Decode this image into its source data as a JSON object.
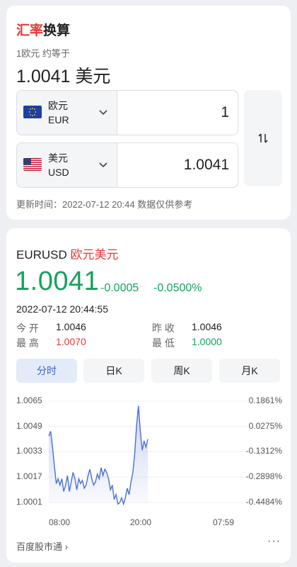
{
  "converter": {
    "title_part1": "汇率",
    "title_part2": "换算",
    "rate_caption": "1欧元 约等于",
    "rate_value": "1.0041 美元",
    "from": {
      "name": "欧元",
      "code": "EUR",
      "amount": "1",
      "flag": "eu-flag-icon"
    },
    "to": {
      "name": "美元",
      "code": "USD",
      "amount": "1.0041",
      "flag": "us-flag-icon"
    },
    "swap_icon": "swap-arrows-icon",
    "update_label": "更新时间：2022-07-12 20:44 数据仅供参考"
  },
  "quote": {
    "symbol": "EURUSD",
    "name": "欧元美元",
    "price": "1.0041",
    "change": "-0.0005",
    "change_pct": "-0.0500%",
    "time": "2022-07-12 20:44:55",
    "open_label": "今  开",
    "open_value": "1.0046",
    "prev_close_label": "昨  收",
    "prev_close_value": "1.0046",
    "high_label": "最  高",
    "high_value": "1.0070",
    "low_label": "最  低",
    "low_value": "1.0000"
  },
  "tabs": [
    "分时",
    "日K",
    "周K",
    "月K"
  ],
  "active_tab": "分时",
  "colors": {
    "up": "#e53935",
    "down": "#16a05d",
    "line": "#4a6fd4",
    "accent": "#3a63c7"
  },
  "chart_data": {
    "type": "area",
    "x_ticks": [
      "08:00",
      "20:00",
      "07:59"
    ],
    "y_ticks": [
      "1.0065",
      "1.0049",
      "1.0033",
      "1.0017",
      "1.0001"
    ],
    "y_pct_ticks": [
      "0.1861%",
      "0.0275%",
      "-0.1312%",
      "-0.2898%",
      "-0.4484%"
    ],
    "ylim": [
      1.0001,
      1.0065
    ],
    "series": [
      {
        "values": [
          1.0043,
          1.0046,
          1.0036,
          1.0024,
          1.0013,
          1.0016,
          1.0012,
          1.0016,
          1.0008,
          1.0012,
          1.0018,
          1.0008,
          1.0014,
          1.002,
          1.0016,
          1.0009,
          1.0016,
          1.0013,
          1.0015,
          1.001,
          1.0012,
          1.0018,
          1.0022,
          1.0016,
          1.0012,
          1.0014,
          1.0019,
          1.0016,
          1.0023,
          1.0018,
          1.0022,
          1.002,
          1.0016,
          1.0009,
          1.0012,
          1.0003,
          1.0006,
          1.0,
          1.0001,
          1.0004,
          1.0,
          1.0004,
          1.001,
          1.0006,
          1.0014,
          1.002,
          1.0032,
          1.005,
          1.0062,
          1.0046,
          1.0034,
          1.004,
          1.0036,
          1.0041
        ]
      }
    ]
  },
  "footer": {
    "source": "百度股市通 ›",
    "more": "···"
  }
}
